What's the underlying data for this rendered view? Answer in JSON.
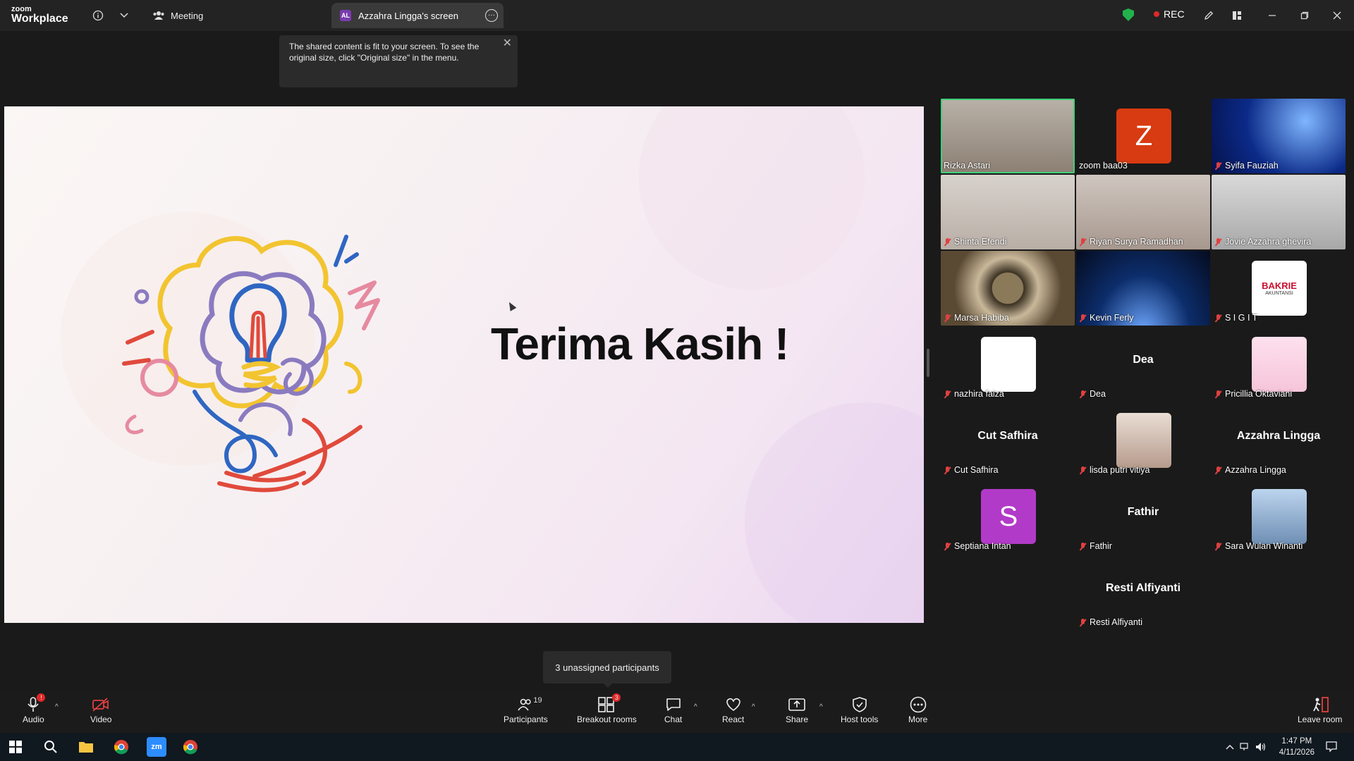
{
  "app": {
    "brand_top": "zoom",
    "brand_bottom": "Workplace"
  },
  "topbar": {
    "meeting_label": "Meeting",
    "share_tab_initials": "AL",
    "share_tab_label": "Azzahra Lingga's screen",
    "rec_label": "REC"
  },
  "tooltip": {
    "text": "The shared content is fit to your screen. To see the original size, click \"Original size\" in the menu."
  },
  "slide": {
    "title": "Terima Kasih !"
  },
  "participants": [
    {
      "name": "Rizka Astari",
      "kind": "photo",
      "muted": false,
      "speaking": true
    },
    {
      "name": "zoom baa03",
      "kind": "letter",
      "letter": "Z",
      "color": "#d83b12",
      "muted": false
    },
    {
      "name": "Syifa Fauziah",
      "kind": "photo",
      "muted": true
    },
    {
      "name": "Shinta Efendi",
      "kind": "photo",
      "muted": true
    },
    {
      "name": "Riyan Surya Ramadhan",
      "kind": "photo",
      "muted": true
    },
    {
      "name": "Jovie Azzahra ghevira",
      "kind": "photo",
      "muted": true
    },
    {
      "name": "Marsa Habiba",
      "kind": "photo",
      "muted": true
    },
    {
      "name": "Kevin Ferly",
      "kind": "photo",
      "muted": true
    },
    {
      "name": "S I G I T",
      "kind": "logo",
      "logo_text": "BAKRIE",
      "logo_sub": "AKUNTANSI",
      "muted": true
    },
    {
      "name": "nazhira faiza",
      "kind": "blank",
      "muted": true
    },
    {
      "name": "Dea",
      "kind": "text",
      "display": "Dea",
      "muted": true
    },
    {
      "name": "Pricillia Oktaviani",
      "kind": "photo",
      "muted": true
    },
    {
      "name": "Cut Safhira",
      "kind": "text",
      "display": "Cut Safhira",
      "muted": true
    },
    {
      "name": "lisda putri vitiya",
      "kind": "photo",
      "muted": true
    },
    {
      "name": "Azzahra Lingga",
      "kind": "text",
      "display": "Azzahra Lingga",
      "muted": true
    },
    {
      "name": "Septiana Intan",
      "kind": "letter",
      "letter": "S",
      "color": "#b23ac8",
      "muted": true
    },
    {
      "name": "Fathir",
      "kind": "text",
      "display": "Fathir",
      "muted": true
    },
    {
      "name": "Sara Wulan Winanti",
      "kind": "photo",
      "muted": true
    },
    {
      "name": "Resti Alfiyanti",
      "kind": "text",
      "display": "Resti Alfiyanti",
      "muted": true
    }
  ],
  "unassigned": {
    "text": "3 unassigned participants"
  },
  "toolbar": {
    "audio": "Audio",
    "video": "Video",
    "participants": "Participants",
    "participants_count": "19",
    "breakout": "Breakout rooms",
    "breakout_badge": "3",
    "chat": "Chat",
    "react": "React",
    "share": "Share",
    "host_tools": "Host tools",
    "more": "More",
    "leave": "Leave room",
    "audio_badge": "!"
  },
  "taskbar": {
    "time": "1:47 PM",
    "date": "4/11/2026"
  },
  "colors": {
    "speaking": "#3ed07a",
    "rec": "#e02828",
    "shield": "#22b24c"
  }
}
